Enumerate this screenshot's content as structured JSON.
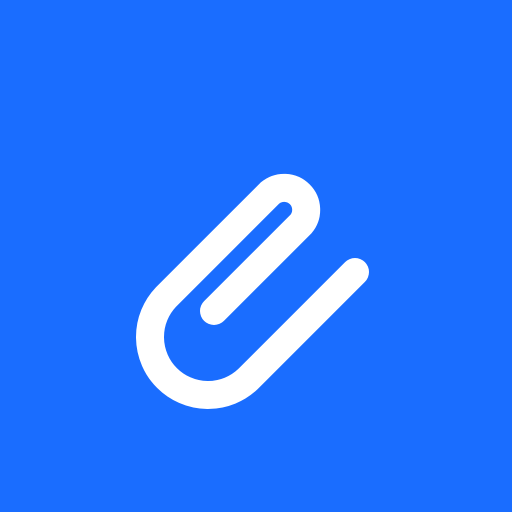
{
  "icon": {
    "name": "paperclip-icon",
    "background_color": "#1A6DFF",
    "glyph_color": "#FFFFFF"
  }
}
